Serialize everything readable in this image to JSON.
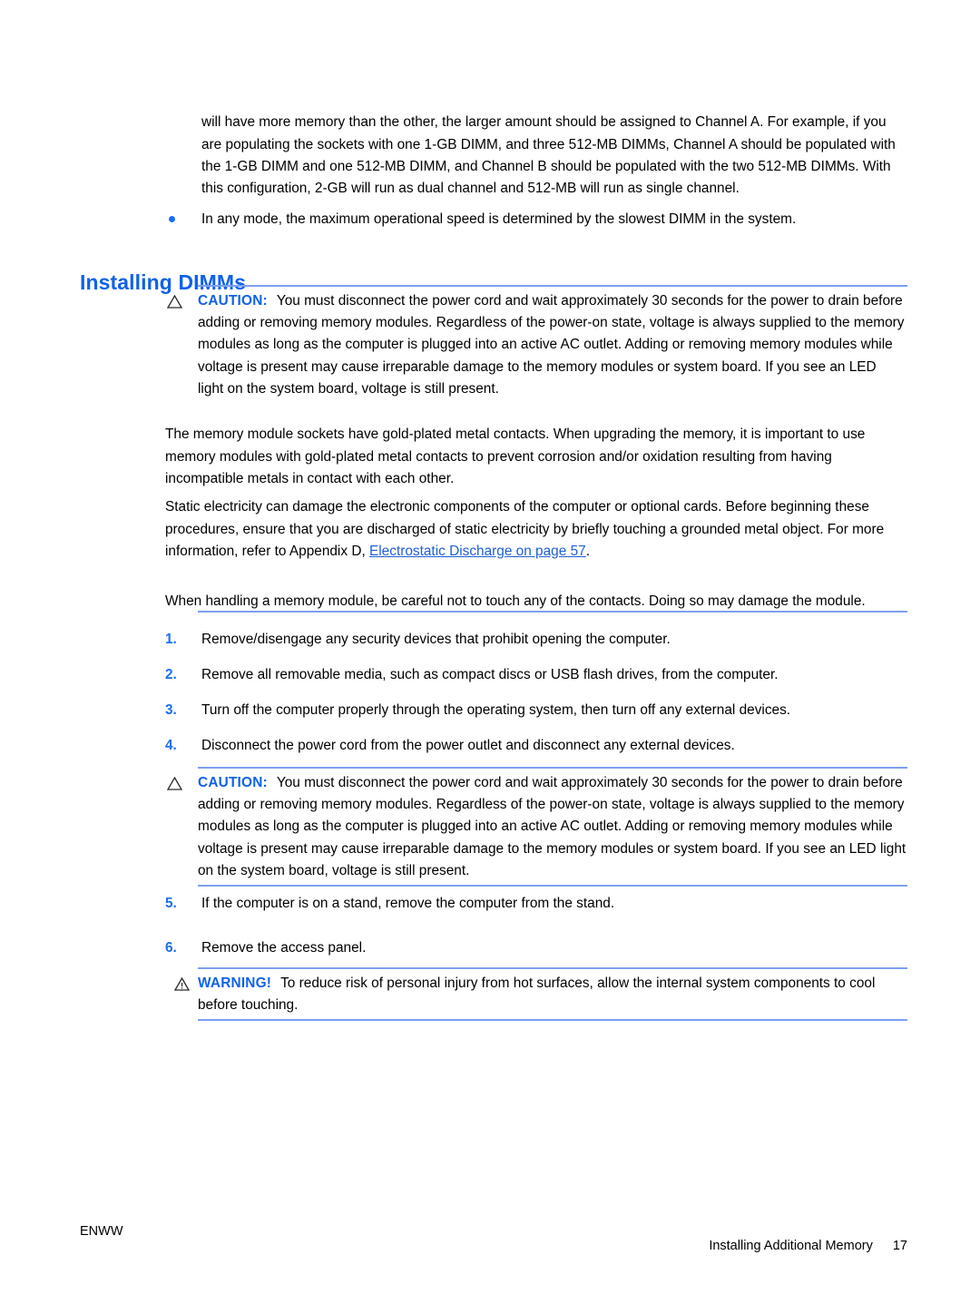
{
  "colors": {
    "heading_blue": "#0f62e8",
    "label_blue": "#0f62e8",
    "rule_blue": "#7e9ff2",
    "link_blue": "#1f5fd8",
    "bullet_blue": "#1a6ef0",
    "body_text": "#000000"
  },
  "body": {
    "intro_paragraph": "will have more memory than the other, the larger amount should be assigned to Channel A. For example, if you are populating the sockets with one 1-GB DIMM, and three 512-MB DIMMs, Channel A should be populated with the 1-GB DIMM and one 512-MB DIMM, and Channel B should be populated with the two 512-MB DIMMs. With this configuration, 2-GB will run as dual channel and 512-MB will run as single channel.",
    "bullet_item": "In any mode, the maximum operational speed is determined by the slowest DIMM in the system.",
    "bullet_glyph": "bullet-dot"
  },
  "heading": {
    "text": "Installing DIMMs"
  },
  "caution_1": {
    "icon": "caution-triangle-icon",
    "label": "CAUTION:",
    "text": "You must disconnect the power cord and wait approximately 30 seconds for the power to drain before adding or removing memory modules. Regardless of the power-on state, voltage is always supplied to the memory modules as long as the computer is plugged into an active AC outlet. Adding or removing memory modules while voltage is present may cause irreparable damage to the memory modules or system board. If you see an LED light on the system board, voltage is still present."
  },
  "paragraphs": {
    "gold_plated": "The memory module sockets have gold-plated metal contacts. When upgrading the memory, it is important to use memory modules with gold-plated metal contacts to prevent corrosion and/or oxidation resulting from having incompatible metals in contact with each other.",
    "static_part1": "Static electricity can damage the electronic components of the computer or optional cards. Before beginning these procedures, ensure that you are discharged of static electricity by briefly touching a grounded metal object. For more information, refer to Appendix D, ",
    "static_link": "Electrostatic Discharge on page 57",
    "static_part2": ".",
    "handling": "When handling a memory module, be careful not to touch any of the contacts. Doing so may damage the module."
  },
  "steps": [
    {
      "num": "1.",
      "text": "Remove/disengage any security devices that prohibit opening the computer."
    },
    {
      "num": "2.",
      "text": "Remove all removable media, such as compact discs or USB flash drives, from the computer."
    },
    {
      "num": "3.",
      "text": "Turn off the computer properly through the operating system, then turn off any external devices."
    },
    {
      "num": "4.",
      "text": "Disconnect the power cord from the power outlet and disconnect any external devices."
    },
    {
      "num": "5.",
      "text": "If the computer is on a stand, remove the computer from the stand."
    },
    {
      "num": "6.",
      "text": "Remove the access panel."
    }
  ],
  "caution_2": {
    "icon": "caution-triangle-icon",
    "label": "CAUTION:",
    "text": "You must disconnect the power cord and wait approximately 30 seconds for the power to drain before adding or removing memory modules. Regardless of the power-on state, voltage is always supplied to the memory modules as long as the computer is plugged into an active AC outlet. Adding or removing memory modules while voltage is present may cause irreparable damage to the memory modules or system board. If you see an LED light on the system board, voltage is still present."
  },
  "warning_1": {
    "icon": "warning-triangle-icon",
    "label": "WARNING!",
    "text": "To reduce risk of personal injury from hot surfaces, allow the internal system components to cool before touching."
  },
  "footer": {
    "left": "ENWW",
    "section": "Installing Additional Memory",
    "page_number": "17"
  }
}
